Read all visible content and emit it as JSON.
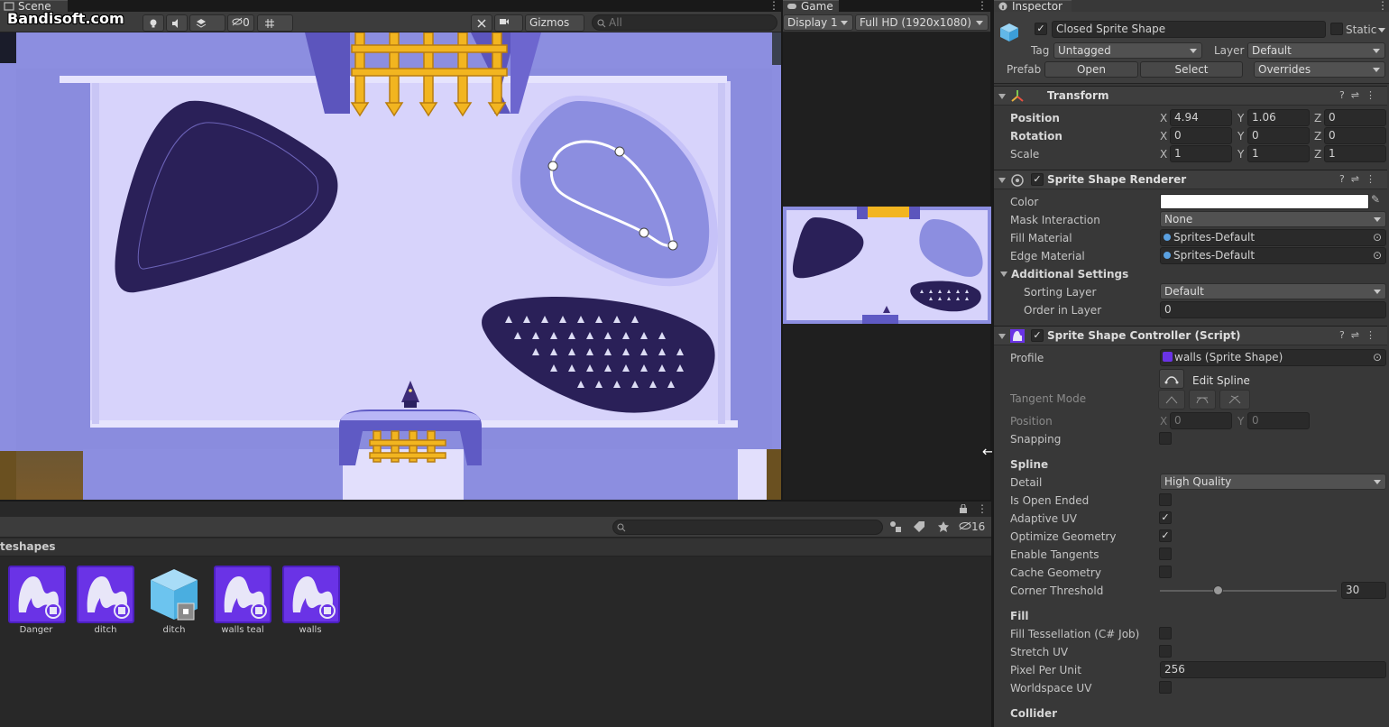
{
  "scene": {
    "tab_label": "Scene",
    "watermark": "Bandisoft.com",
    "toolbar": {
      "hidden_count": "0",
      "gizmos_label": "Gizmos",
      "search_placeholder": "All"
    }
  },
  "game": {
    "tab_label": "Game",
    "display_label": "Display 1",
    "resolution_label": "Full HD (1920x1080)"
  },
  "project": {
    "breadcrumb": "teshapes",
    "hidden_count": "16",
    "assets": [
      {
        "label": "Danger",
        "icon": "sprite-shape-profile-icon"
      },
      {
        "label": "ditch",
        "icon": "sprite-shape-profile-icon"
      },
      {
        "label": "ditch",
        "icon": "prefab-cube-icon"
      },
      {
        "label": "walls teal",
        "icon": "sprite-shape-profile-icon"
      },
      {
        "label": "walls",
        "icon": "sprite-shape-profile-icon"
      }
    ]
  },
  "inspector": {
    "tab_label": "Inspector",
    "object_name": "Closed Sprite Shape",
    "static_label": "Static",
    "tag_label": "Tag",
    "tag_value": "Untagged",
    "layer_label": "Layer",
    "layer_value": "Default",
    "prefab_label": "Prefab",
    "open_label": "Open",
    "select_label": "Select",
    "overrides_label": "Overrides",
    "transform": {
      "title": "Transform",
      "position_label": "Position",
      "rotation_label": "Rotation",
      "scale_label": "Scale",
      "position": {
        "x": "4.94",
        "y": "1.06",
        "z": "0"
      },
      "rotation": {
        "x": "0",
        "y": "0",
        "z": "0"
      },
      "scale": {
        "x": "1",
        "y": "1",
        "z": "1"
      }
    },
    "renderer": {
      "title": "Sprite Shape Renderer",
      "color_label": "Color",
      "color_value": "#FFFFFF",
      "mask_label": "Mask Interaction",
      "mask_value": "None",
      "fill_material_label": "Fill Material",
      "fill_material_value": "Sprites-Default",
      "edge_material_label": "Edge Material",
      "edge_material_value": "Sprites-Default",
      "additional_label": "Additional Settings",
      "sorting_layer_label": "Sorting Layer",
      "sorting_layer_value": "Default",
      "order_label": "Order in Layer",
      "order_value": "0"
    },
    "controller": {
      "title": "Sprite Shape Controller (Script)",
      "profile_label": "Profile",
      "profile_value": "walls (Sprite Shape)",
      "edit_spline_label": "Edit Spline",
      "tangent_mode_label": "Tangent Mode",
      "position_label": "Position",
      "pos_x": "0",
      "pos_y": "0",
      "snapping_label": "Snapping",
      "spline_header": "Spline",
      "detail_label": "Detail",
      "detail_value": "High Quality",
      "open_ended_label": "Is Open Ended",
      "adaptive_uv_label": "Adaptive UV",
      "optimize_label": "Optimize Geometry",
      "tangents_label": "Enable Tangents",
      "cache_label": "Cache Geometry",
      "corner_label": "Corner Threshold",
      "corner_value": "30",
      "corner_fraction": 0.33,
      "fill_header": "Fill",
      "tessellation_label": "Fill Tessellation (C# Job)",
      "stretch_uv_label": "Stretch UV",
      "ppu_label": "Pixel Per Unit",
      "ppu_value": "256",
      "worldspace_label": "Worldspace UV",
      "collider_header": "Collider"
    }
  },
  "axis_labels": {
    "x": "X",
    "y": "Y",
    "z": "Z"
  }
}
